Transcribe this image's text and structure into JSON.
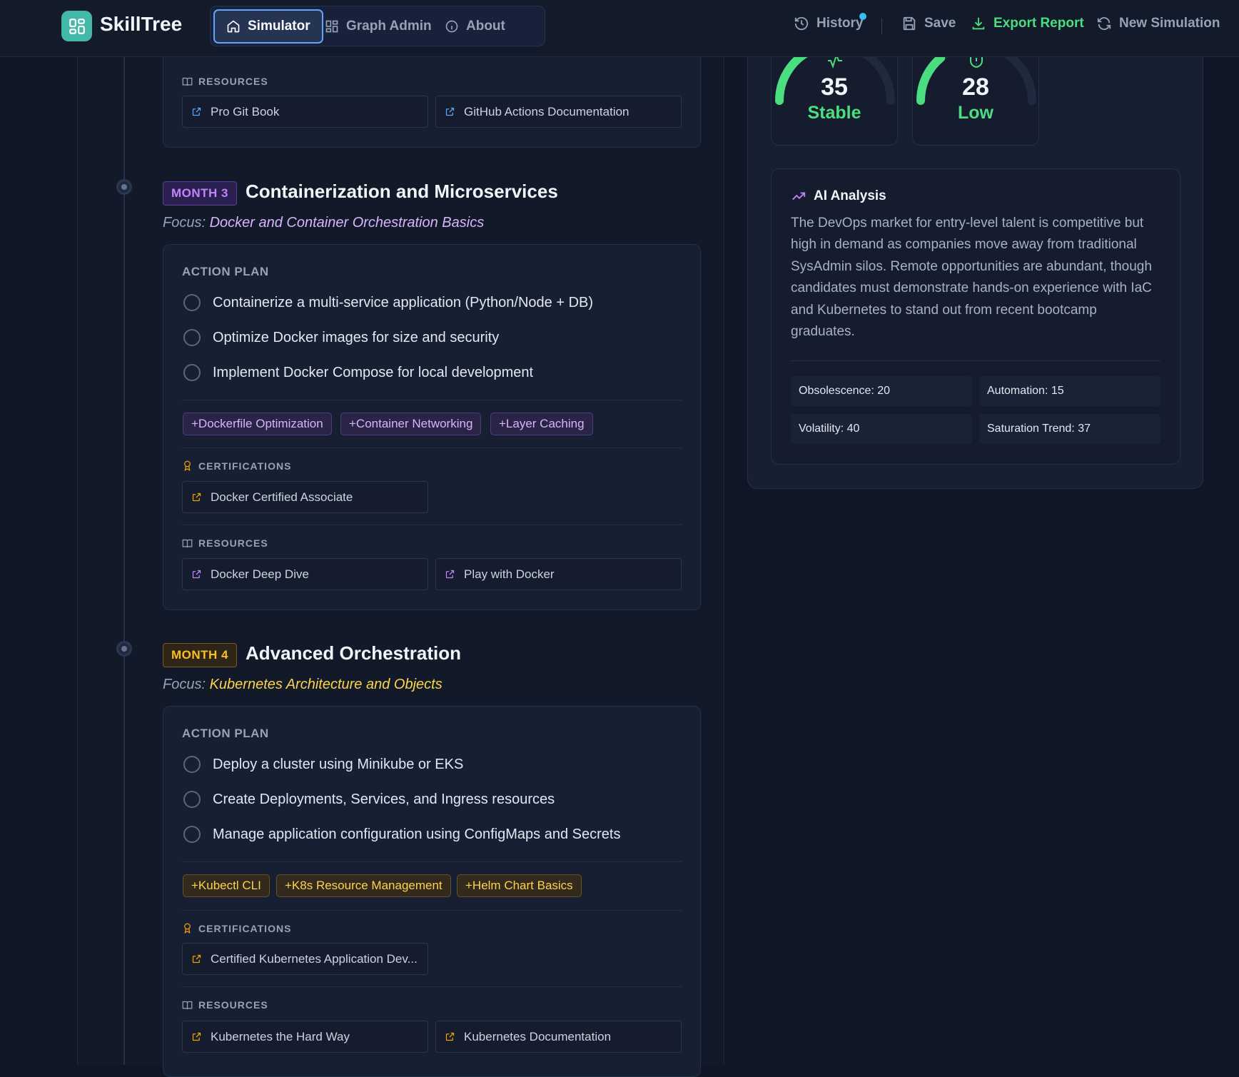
{
  "app": {
    "name": "SkillTree",
    "nav_tabs": [
      {
        "label": "Simulator",
        "active": true
      },
      {
        "label": "Graph Admin",
        "active": false
      },
      {
        "label": "About",
        "active": false
      }
    ],
    "actions": {
      "history": "History",
      "save": "Save",
      "export": "Export Report",
      "new_simulation": "New Simulation"
    }
  },
  "months": [
    {
      "partial_top": true,
      "resources_label": "RESOURCES",
      "resources": [
        "Pro Git Book",
        "GitHub Actions Documentation"
      ]
    },
    {
      "badge": "MONTH 3",
      "title": "Containerization and Microservices",
      "focus_prefix": "Focus:",
      "focus": "Docker and Container Orchestration Basics",
      "action_plan_label": "ACTION PLAN",
      "tasks": [
        "Containerize a multi-service application (Python/Node + DB)",
        "Optimize Docker images for size and security",
        "Implement Docker Compose for local development"
      ],
      "skills": [
        "+Dockerfile Optimization",
        "+Container Networking",
        "+Layer Caching"
      ],
      "certifications_label": "CERTIFICATIONS",
      "certifications": [
        "Docker Certified Associate"
      ],
      "resources_label": "RESOURCES",
      "resources": [
        "Docker Deep Dive",
        "Play with Docker"
      ],
      "accent": "#c084fc"
    },
    {
      "badge": "MONTH 4",
      "title": "Advanced Orchestration",
      "focus_prefix": "Focus:",
      "focus": "Kubernetes Architecture and Objects",
      "action_plan_label": "ACTION PLAN",
      "tasks": [
        "Deploy a cluster using Minikube or EKS",
        "Create Deployments, Services, and Ingress resources",
        "Manage application configuration using ConfigMaps and Secrets"
      ],
      "skills": [
        "+Kubectl CLI",
        "+K8s Resource Management",
        "+Helm Chart Basics"
      ],
      "certifications_label": "CERTIFICATIONS",
      "certifications": [
        "Certified Kubernetes Application Dev..."
      ],
      "resources_label": "RESOURCES",
      "resources": [
        "Kubernetes the Hard Way",
        "Kubernetes Documentation"
      ],
      "accent": "#fbbf24"
    }
  ],
  "gauges": [
    {
      "value": "35",
      "label": "Stable",
      "level": 0.35,
      "icon": "activity-icon"
    },
    {
      "value": "28",
      "label": "Low",
      "level": 0.28,
      "icon": "shield-icon"
    }
  ],
  "ai_analysis": {
    "title": "AI Analysis",
    "text": "The DevOps market for entry-level talent is competitive but high in demand as companies move away from traditional SysAdmin silos. Remote opportunities are abundant, though candidates must demonstrate hands-on experience with IaC and Kubernetes to stand out from recent bootcamp graduates.",
    "metrics": [
      "Obsolescence: 20",
      "Automation: 15",
      "Volatility: 40",
      "Saturation Trend: 37"
    ]
  },
  "colors": {
    "background": "#101626",
    "brand": "#43b7a8",
    "green": "#4ade80",
    "purple": "#c084fc",
    "amber": "#fbbf24",
    "link_blue": "#60a5fa"
  }
}
